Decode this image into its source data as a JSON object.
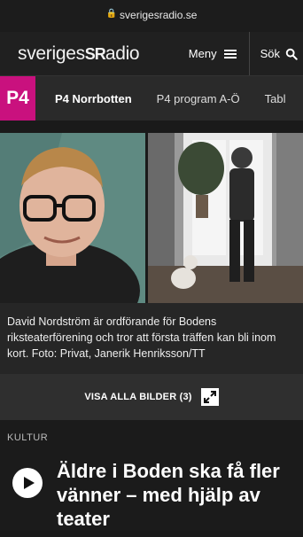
{
  "url_bar": {
    "url": "sverigesradio.se"
  },
  "header": {
    "logo_pre": "sveriges",
    "logo_mark": "SR",
    "logo_post": "adio",
    "menu_label": "Meny",
    "search_label": "Sök"
  },
  "channel_bar": {
    "badge": "P4",
    "badge_color": "#c9117e",
    "title": "P4 Norrbotten",
    "links": [
      "P4 program A-Ö",
      "Tabl"
    ]
  },
  "gallery": {
    "caption": "David Nordström är ordförande för Bodens riksteaterförening och tror att första träffen kan bli inom kort. Foto: Privat, Janerik Henriksson/TT",
    "show_all_label": "VISA ALLA BILDER (3)"
  },
  "article": {
    "category": "KULTUR",
    "headline": "Äldre i Boden ska få fler vänner – med hjälp av teater"
  }
}
